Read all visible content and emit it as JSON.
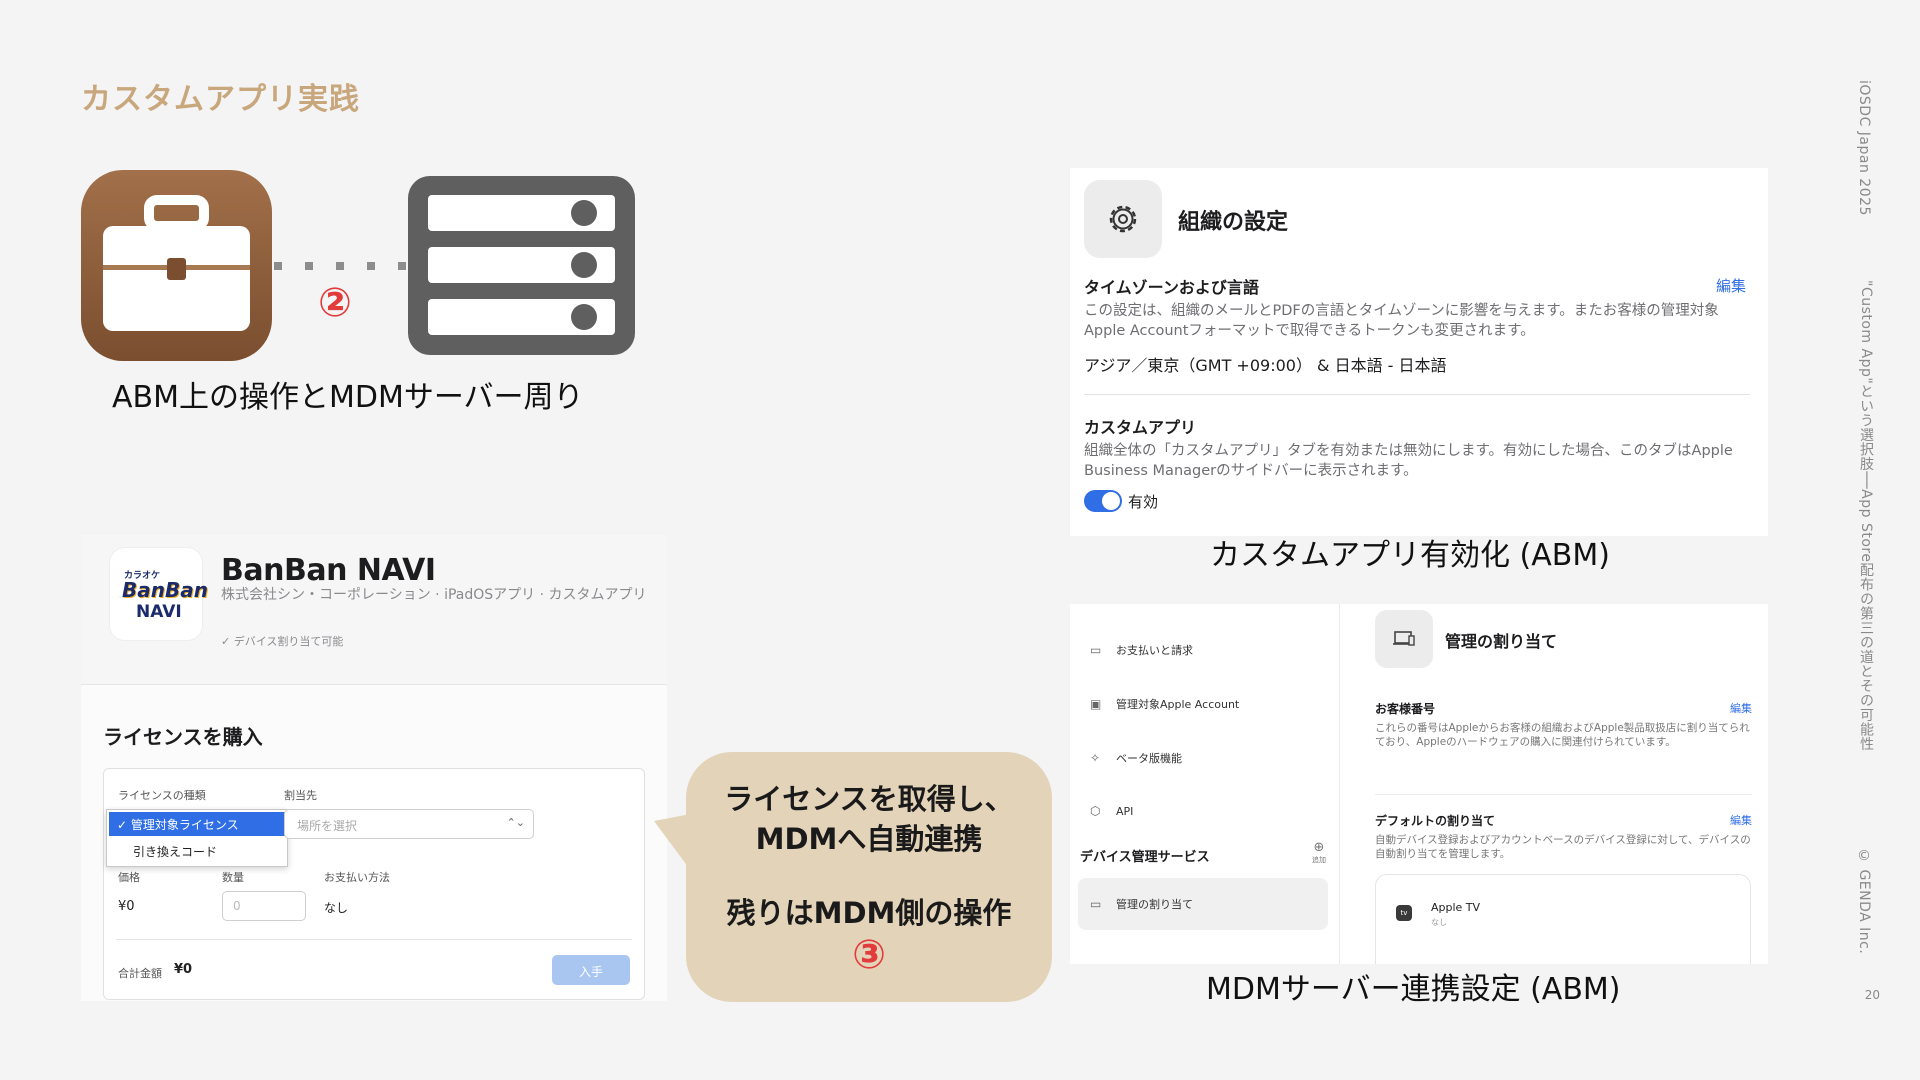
{
  "slide": {
    "title": "カスタムアプリ実践",
    "side_conference": "iOSDC Japan 2025",
    "side_talk": "\"Custom App\"という選択肢──App Store配布の第三の道とその可能性",
    "side_copyright": "© GENDA Inc.",
    "page_number": "20"
  },
  "step2": {
    "number": "②",
    "caption": "ABM上の操作とMDMサーバー周り",
    "icons": [
      "briefcase-icon",
      "server-icon"
    ]
  },
  "org_settings": {
    "title": "組織の設定",
    "timezone": {
      "title": "タイムゾーンおよび言語",
      "edit": "編集",
      "desc": "この設定は、組織のメールとPDFの言語とタイムゾーンに影響を与えます。またお客様の管理対象Apple Accountフォーマットで取得できるトークンも変更されます。",
      "value": "アジア／東京（GMT +09:00） & 日本語 - 日本語"
    },
    "custom_app": {
      "title": "カスタムアプリ",
      "desc": "組織全体の「カスタムアプリ」タブを有効または無効にします。有効にした場合、このタブはApple Business Managerのサイドバーに表示されます。",
      "toggle_label": "有効",
      "toggle_on": true
    },
    "caption": "カスタムアプリ有効化 (ABM)"
  },
  "banban": {
    "logo_small": "カラオケ",
    "logo_main": "BanBan",
    "logo_sub": "NAVI",
    "app_name": "BanBan NAVI",
    "app_sub": "株式会社シン・コーポレーション · iPadOSアプリ · カスタムアプリ",
    "app_note": "✓ デバイス割り当て可能",
    "buy_title": "ライセンスを購入",
    "license_type_label": "ライセンスの種類",
    "license_options": [
      "管理対象ライセンス",
      "引き換えコード"
    ],
    "license_selected": "管理対象ライセンス",
    "assign_label": "割当先",
    "assign_placeholder": "場所を選択",
    "price_label": "価格",
    "price_value": "¥0",
    "qty_label": "数量",
    "qty_placeholder": "0",
    "payment_label": "お支払い方法",
    "payment_value": "なし",
    "total_label": "合計金額",
    "total_value": "¥0",
    "buy_button": "入手"
  },
  "callout": {
    "line1": "ライセンスを取得し、",
    "line2": "MDMへ自動連携",
    "line3": "残りはMDM側の操作",
    "number": "③"
  },
  "mdm": {
    "sidebar": [
      {
        "label": "お支払いと請求",
        "icon": "card-icon"
      },
      {
        "label": "管理対象Apple Account",
        "icon": "id-card-icon"
      },
      {
        "label": "ベータ版機能",
        "icon": "sparkle-icon"
      },
      {
        "label": "API",
        "icon": "cube-icon"
      }
    ],
    "section": "デバイス管理サービス",
    "add_label": "追加",
    "active_item": "管理の割り当て",
    "title": "管理の割り当て",
    "customer_number": {
      "title": "お客様番号",
      "edit": "編集",
      "desc": "これらの番号はAppleからお客様の組織およびApple製品取扱店に割り当てられており、Appleのハードウェアの購入に関連付けられています。"
    },
    "default_assign": {
      "title": "デフォルトの割り当て",
      "edit": "編集",
      "desc": "自動デバイス登録およびアカウントベースのデバイス登録に対して、デバイスの自動割り当てを管理します。"
    },
    "device_name": "Apple TV",
    "device_sub": "なし",
    "caption": "MDMサーバー連携設定 (ABM)"
  },
  "colors": {
    "title": "#c9a77c",
    "badge": "#e23b3b",
    "callout_bg": "#e3d3b9",
    "accent": "#2f6ee5",
    "briefcase": "#8b5a36",
    "server": "#5f5f5f"
  }
}
